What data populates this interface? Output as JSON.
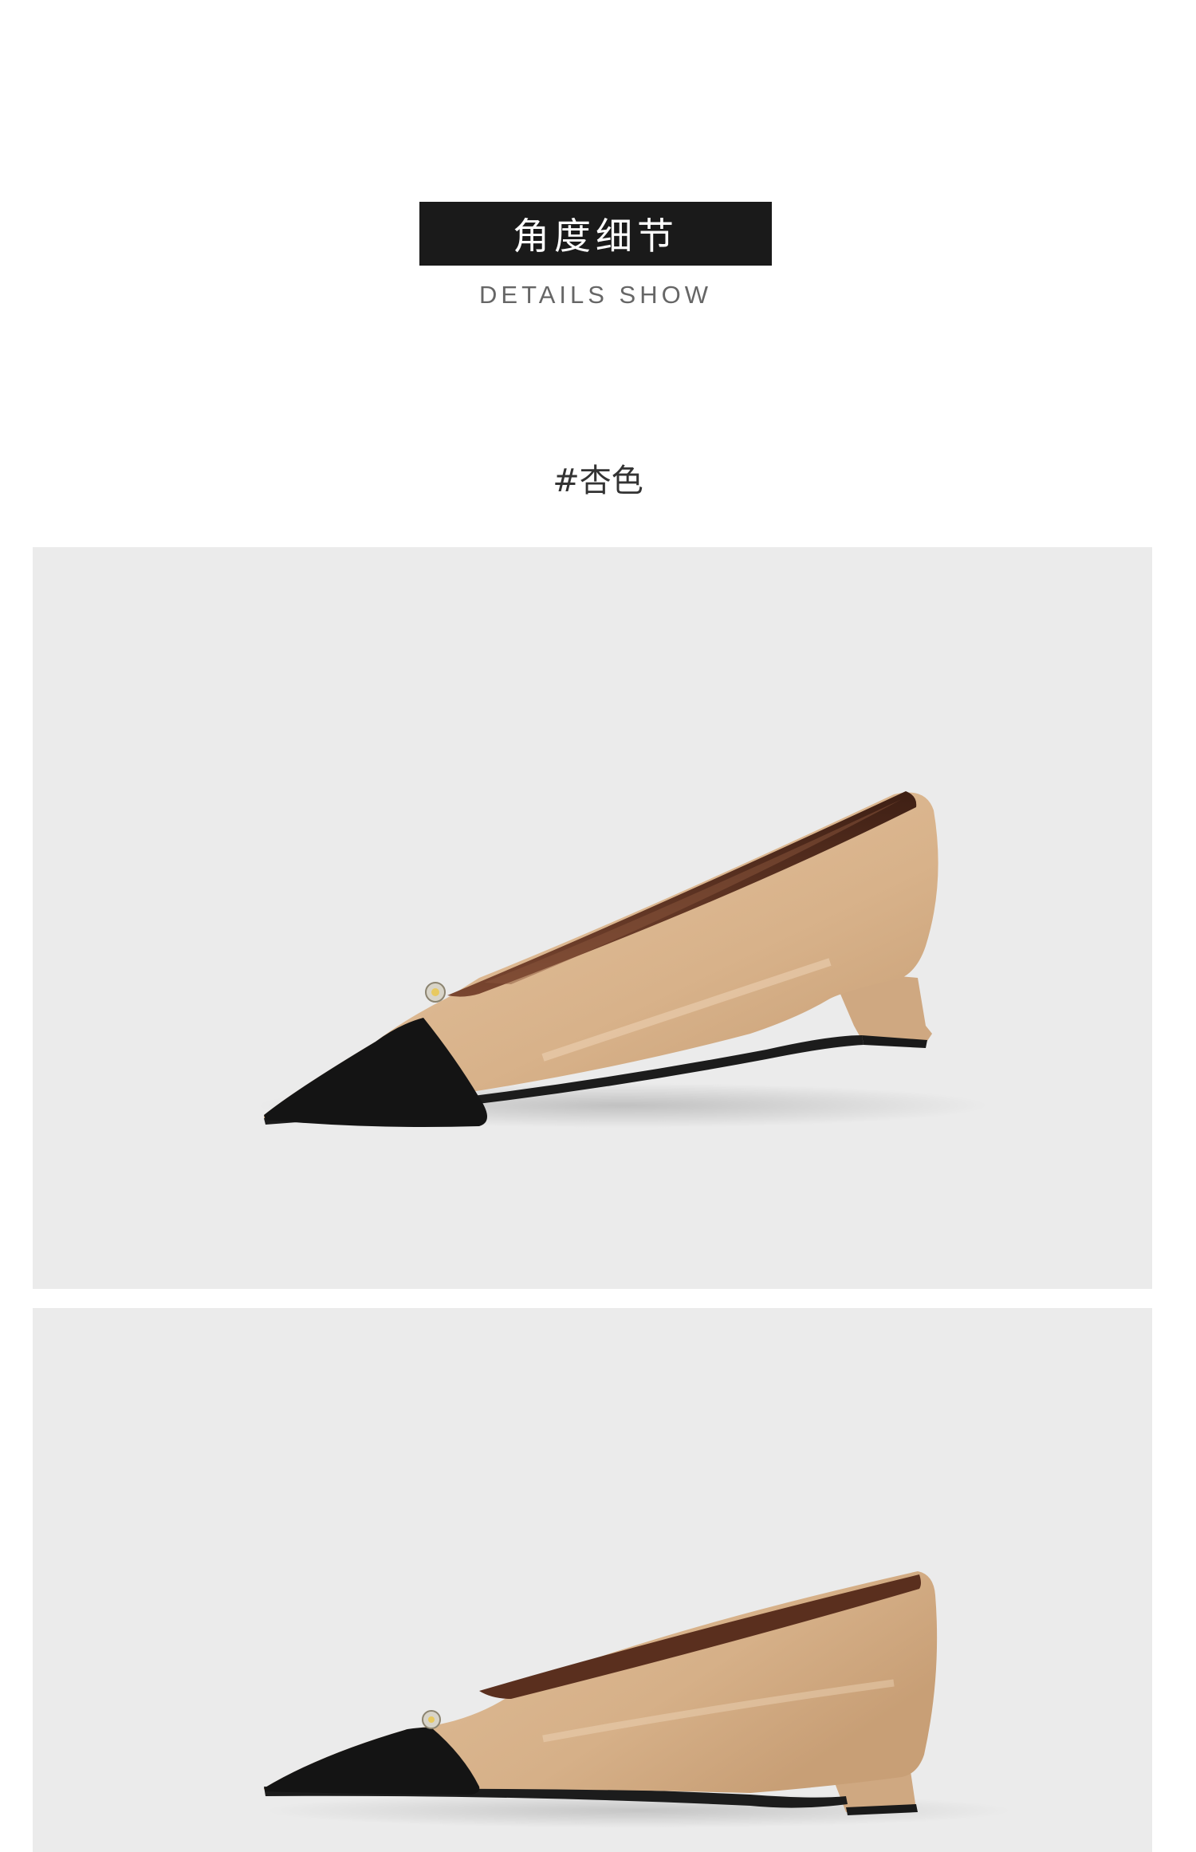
{
  "header": {
    "title": "角度细节",
    "subtitle": "DETAILS SHOW"
  },
  "color_label": "#杏色",
  "colors": {
    "title_bar": "#1a1a1a",
    "panel_background": "#ebebeb",
    "shoe_upper": "#dcb690",
    "shoe_toe_cap": "#141414",
    "shoe_lining": "#5a2f1e"
  },
  "photos": [
    {
      "subject": "shoe-three-quarter-view"
    },
    {
      "subject": "shoe-side-view"
    }
  ]
}
